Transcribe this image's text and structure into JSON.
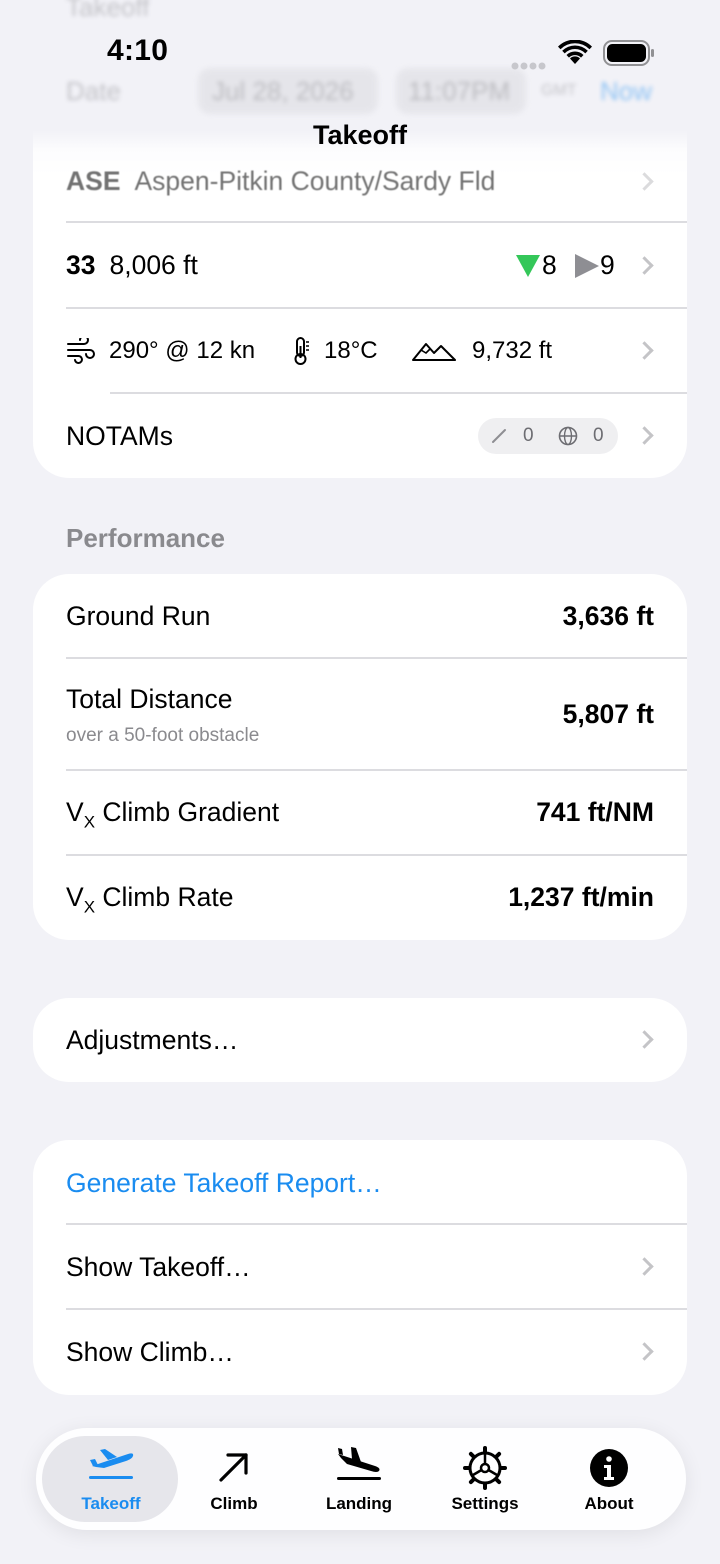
{
  "status_bar": {
    "time": "4:10"
  },
  "nav": {
    "title": "Takeoff"
  },
  "ghost_header": {
    "section": "Takeoff",
    "date_label": "Date",
    "date": "Jul 28, 2026",
    "time": "11:07PM",
    "tz": "GMT",
    "now": "Now"
  },
  "airport": {
    "code": "ASE",
    "name": "Aspen-Pitkin County/Sardy Fld"
  },
  "runway": {
    "number": "33",
    "length": "8,006 ft",
    "headwind": "8",
    "crosswind": "9"
  },
  "weather": {
    "wind": "290° @ 12 kn",
    "temperature": "18°C",
    "density_altitude": "9,732 ft"
  },
  "notams": {
    "label": "NOTAMs",
    "local_count": "0",
    "global_count": "0"
  },
  "performance": {
    "title": "Performance",
    "ground_run": {
      "label": "Ground Run",
      "value": "3,636 ft"
    },
    "total_distance": {
      "label": "Total Distance",
      "sublabel": "over a 50-foot obstacle",
      "value": "5,807 ft"
    },
    "vx_gradient": {
      "label_v": "V",
      "label_sub": "X",
      "label_rest": " Climb Gradient",
      "value": "741 ft/NM"
    },
    "vx_rate": {
      "label_v": "V",
      "label_sub": "X",
      "label_rest": " Climb Rate",
      "value": "1,237 ft/min"
    }
  },
  "adjustments": {
    "label": "Adjustments…"
  },
  "actions": {
    "generate_report": "Generate Takeoff Report…",
    "show_takeoff": "Show Takeoff…",
    "show_climb": "Show Climb…"
  },
  "tabs": [
    {
      "label": "Takeoff",
      "icon": "takeoff-icon",
      "active": true
    },
    {
      "label": "Climb",
      "icon": "climb-arrow-icon",
      "active": false
    },
    {
      "label": "Landing",
      "icon": "landing-icon",
      "active": false
    },
    {
      "label": "Settings",
      "icon": "gear-icon",
      "active": false
    },
    {
      "label": "About",
      "icon": "info-icon",
      "active": false
    }
  ],
  "colors": {
    "accent": "#1a8cf0",
    "headwind_green": "#34c759",
    "crosswind_gray": "#8e8e93",
    "background": "#f2f2f7"
  }
}
